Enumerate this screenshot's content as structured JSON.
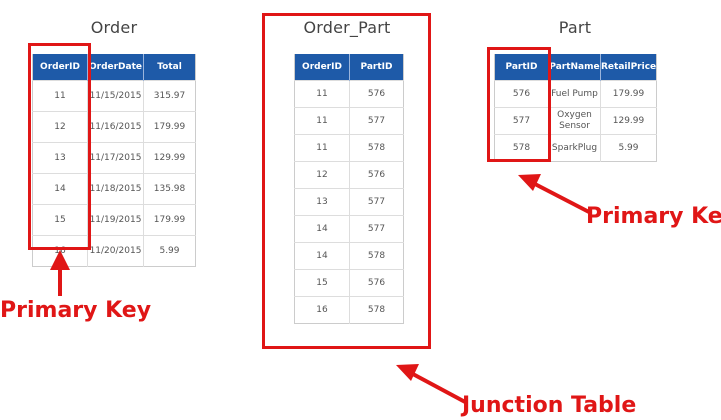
{
  "tables": {
    "order": {
      "title": "Order",
      "headers": [
        "OrderID",
        "OrderDate",
        "Total"
      ],
      "rows": [
        [
          "11",
          "11/15/2015",
          "315.97"
        ],
        [
          "12",
          "11/16/2015",
          "179.99"
        ],
        [
          "13",
          "11/17/2015",
          "129.99"
        ],
        [
          "14",
          "11/18/2015",
          "135.98"
        ],
        [
          "15",
          "11/19/2015",
          "179.99"
        ],
        [
          "16",
          "11/20/2015",
          "5.99"
        ]
      ]
    },
    "order_part": {
      "title": "Order_Part",
      "headers": [
        "OrderID",
        "PartID"
      ],
      "rows": [
        [
          "11",
          "576"
        ],
        [
          "11",
          "577"
        ],
        [
          "11",
          "578"
        ],
        [
          "12",
          "576"
        ],
        [
          "13",
          "577"
        ],
        [
          "14",
          "577"
        ],
        [
          "14",
          "578"
        ],
        [
          "15",
          "576"
        ],
        [
          "16",
          "578"
        ]
      ]
    },
    "part": {
      "title": "Part",
      "headers": [
        "PartID",
        "PartName",
        "RetailPrice"
      ],
      "rows": [
        [
          "576",
          "Fuel Pump",
          "179.99"
        ],
        [
          "577",
          "Oxygen Sensor",
          "129.99"
        ],
        [
          "578",
          "SparkPlug",
          "5.99"
        ]
      ]
    }
  },
  "annotations": {
    "order_primary_key": "Primary Key",
    "part_primary_key": "Primary Key",
    "junction_table": "Junction Table"
  },
  "colors": {
    "header_blue": "#1e5aa8",
    "highlight_red": "#e01616"
  }
}
